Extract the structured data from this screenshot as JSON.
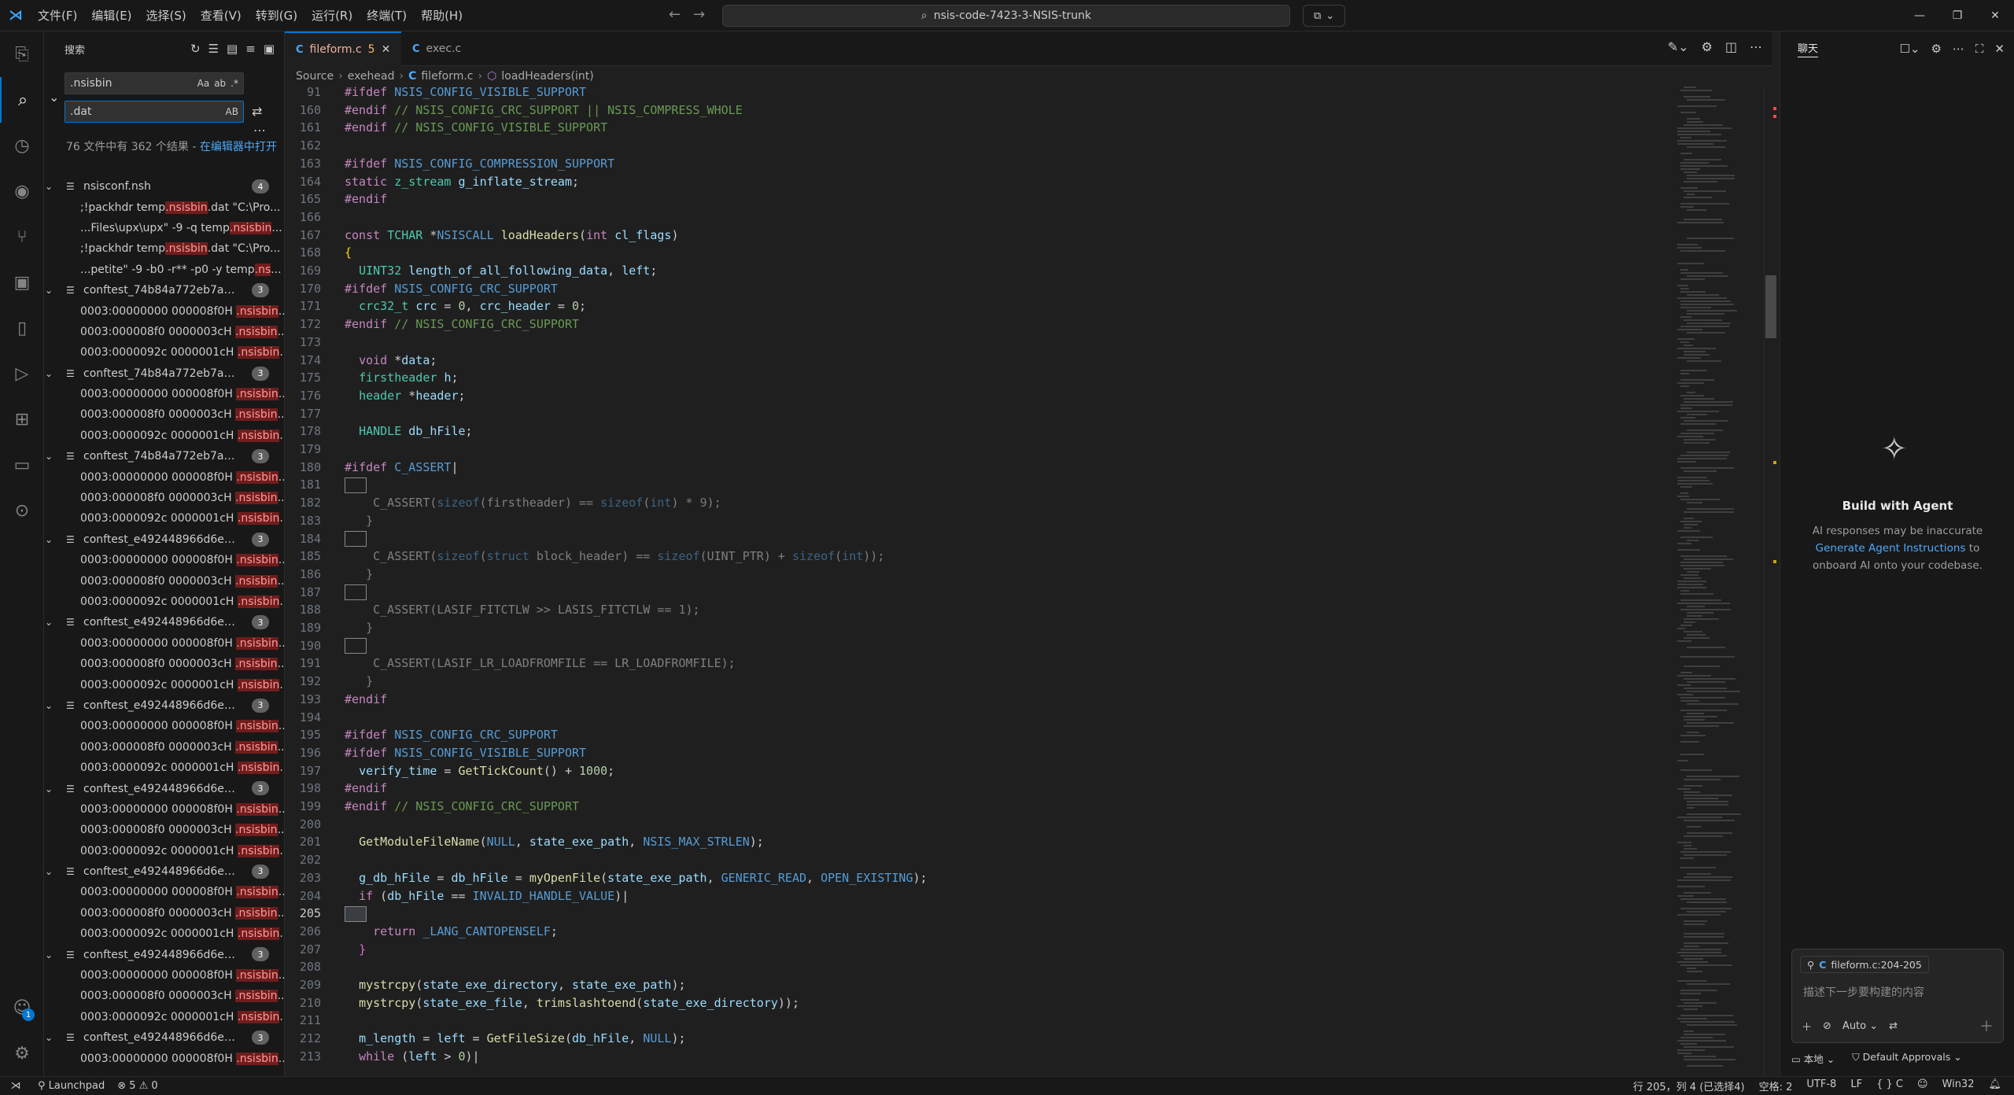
{
  "titlebar": {
    "logo": "⋊",
    "menu": [
      "文件(F)",
      "编辑(E)",
      "选择(S)",
      "查看(V)",
      "转到(G)",
      "运行(R)",
      "终端(T)",
      "帮助(H)"
    ],
    "command_center": "nsis-code-7423-3-NSIS-trunk",
    "search_icon": "search-icon",
    "copilot_icon": "copilot-icon"
  },
  "sidebar": {
    "title": "搜索",
    "search_value": ".nsisbin",
    "search_opts": [
      "Aa",
      "ab",
      ".*"
    ],
    "replace_value": ".dat",
    "replace_opt": "AB",
    "summary_a": "76 文件中有 362 个结果 - ",
    "summary_link": "在编辑器中打开",
    "results": [
      {
        "type": "file",
        "name": "nsisconf.nsh",
        "count": "4",
        "top": 0
      },
      {
        "type": "match",
        "pre": ";!packhdr temp",
        "hl": ".nsisbin",
        "post": ".dat \"C:\\Pro..."
      },
      {
        "type": "match",
        "pre": "...Files\\upx\\upx\" -9 -q temp",
        "hl": ".nsisbin",
        "post": "..."
      },
      {
        "type": "match",
        "pre": ";!packhdr temp",
        "hl": ".nsisbin",
        "post": ".dat \"C:\\Pro..."
      },
      {
        "type": "match",
        "pre": "...petite\" -9 -b0 -r** -p0 -y temp",
        "hl": ".ns",
        "post": "..."
      },
      {
        "type": "file",
        "name": "conftest_74b84a772eb7a0f...",
        "count": "3"
      },
      {
        "type": "match",
        "pre": "0003:00000000 000008f0H ",
        "hl": ".nsisbin",
        "post": "..."
      },
      {
        "type": "match",
        "pre": "0003:000008f0 0000003cH ",
        "hl": ".nsisbin",
        "post": "..."
      },
      {
        "type": "match",
        "pre": "0003:0000092c 0000001cH ",
        "hl": ".nsisbin",
        "post": "..."
      },
      {
        "type": "file",
        "name": "conftest_74b84a772eb7a0f...",
        "count": "3"
      },
      {
        "type": "match",
        "pre": "0003:00000000 000008f0H ",
        "hl": ".nsisbin",
        "post": "..."
      },
      {
        "type": "match",
        "pre": "0003:000008f0 0000003cH ",
        "hl": ".nsisbin",
        "post": "..."
      },
      {
        "type": "match",
        "pre": "0003:0000092c 0000001cH ",
        "hl": ".nsisbin",
        "post": "..."
      },
      {
        "type": "file",
        "name": "conftest_74b84a772eb7a0f...",
        "count": "3"
      },
      {
        "type": "match",
        "pre": "0003:00000000 000008f0H ",
        "hl": ".nsisbin",
        "post": "..."
      },
      {
        "type": "match",
        "pre": "0003:000008f0 0000003cH ",
        "hl": ".nsisbin",
        "post": "..."
      },
      {
        "type": "match",
        "pre": "0003:0000092c 0000001cH ",
        "hl": ".nsisbin",
        "post": "..."
      },
      {
        "type": "file",
        "name": "conftest_e492448966d6e04...",
        "count": "3"
      },
      {
        "type": "match",
        "pre": "0003:00000000 000008f0H ",
        "hl": ".nsisbin",
        "post": "..."
      },
      {
        "type": "match",
        "pre": "0003:000008f0 0000003cH ",
        "hl": ".nsisbin",
        "post": "..."
      },
      {
        "type": "match",
        "pre": "0003:0000092c 0000001cH ",
        "hl": ".nsisbin",
        "post": "..."
      },
      {
        "type": "file",
        "name": "conftest_e492448966d6e04...",
        "count": "3"
      },
      {
        "type": "match",
        "pre": "0003:00000000 000008f0H ",
        "hl": ".nsisbin",
        "post": "..."
      },
      {
        "type": "match",
        "pre": "0003:000008f0 0000003cH ",
        "hl": ".nsisbin",
        "post": "..."
      },
      {
        "type": "match",
        "pre": "0003:0000092c 0000001cH ",
        "hl": ".nsisbin",
        "post": "..."
      },
      {
        "type": "file",
        "name": "conftest_e492448966d6e04...",
        "count": "3"
      },
      {
        "type": "match",
        "pre": "0003:00000000 000008f0H ",
        "hl": ".nsisbin",
        "post": "..."
      },
      {
        "type": "match",
        "pre": "0003:000008f0 0000003cH ",
        "hl": ".nsisbin",
        "post": "..."
      },
      {
        "type": "match",
        "pre": "0003:0000092c 0000001cH ",
        "hl": ".nsisbin",
        "post": "..."
      },
      {
        "type": "file",
        "name": "conftest_e492448966d6e04...",
        "count": "3"
      },
      {
        "type": "match",
        "pre": "0003:00000000 000008f0H ",
        "hl": ".nsisbin",
        "post": "..."
      },
      {
        "type": "match",
        "pre": "0003:000008f0 0000003cH ",
        "hl": ".nsisbin",
        "post": "..."
      },
      {
        "type": "match",
        "pre": "0003:0000092c 0000001cH ",
        "hl": ".nsisbin",
        "post": "..."
      },
      {
        "type": "file",
        "name": "conftest_e492448966d6e04...",
        "count": "3"
      },
      {
        "type": "match",
        "pre": "0003:00000000 000008f0H ",
        "hl": ".nsisbin",
        "post": "..."
      },
      {
        "type": "match",
        "pre": "0003:000008f0 0000003cH ",
        "hl": ".nsisbin",
        "post": "..."
      },
      {
        "type": "match",
        "pre": "0003:0000092c 0000001cH ",
        "hl": ".nsisbin",
        "post": "..."
      },
      {
        "type": "file",
        "name": "conftest_e492448966d6e04...",
        "count": "3"
      },
      {
        "type": "match",
        "pre": "0003:00000000 000008f0H ",
        "hl": ".nsisbin",
        "post": "..."
      },
      {
        "type": "match",
        "pre": "0003:000008f0 0000003cH ",
        "hl": ".nsisbin",
        "post": "..."
      },
      {
        "type": "match",
        "pre": "0003:0000092c 0000001cH ",
        "hl": ".nsisbin",
        "post": "..."
      },
      {
        "type": "file",
        "name": "conftest_e492448966d6e04...",
        "count": "3"
      },
      {
        "type": "match",
        "pre": "0003:00000000 000008f0H ",
        "hl": ".nsisbin",
        "post": "..."
      }
    ]
  },
  "tabs": [
    {
      "name": "fileform.c",
      "mod": "5",
      "active": true
    },
    {
      "name": "exec.c",
      "mod": "",
      "active": false
    }
  ],
  "breadcrumb": {
    "a": "Source",
    "b": "exehead",
    "c": "fileform.c",
    "d": "loadHeaders(int)"
  },
  "code": [
    {
      "n": "91",
      "h": "<span class='mac'>#ifdef</span> <span class='mc'>NSIS_CONFIG_VISIBLE_SUPPORT</span>"
    },
    {
      "n": "160",
      "h": "<span class='mac'>#endif</span> <span class='cm'>// NSIS_CONFIG_CRC_SUPPORT || NSIS_COMPRESS_WHOLE</span>"
    },
    {
      "n": "161",
      "h": "<span class='mac'>#endif</span> <span class='cm'>// NSIS_CONFIG_VISIBLE_SUPPORT</span>"
    },
    {
      "n": "162",
      "h": ""
    },
    {
      "n": "163",
      "h": "<span class='mac'>#ifdef</span> <span class='mc'>NSIS_CONFIG_COMPRESSION_SUPPORT</span>"
    },
    {
      "n": "164",
      "h": "<span class='k'>static</span> <span class='ty'>z_stream</span> <span class='v'>g_inflate_stream</span>;"
    },
    {
      "n": "165",
      "h": "<span class='mac'>#endif</span>"
    },
    {
      "n": "166",
      "h": ""
    },
    {
      "n": "167",
      "h": "<span class='k'>const</span> <span class='ty'>TCHAR</span> *<span class='mc'>NSISCALL</span> <span class='fn'>loadHeaders</span>(<span class='k'>int</span> <span class='v'>cl_flags</span>)"
    },
    {
      "n": "168",
      "h": "<span style='color:#ffd700'>{</span>"
    },
    {
      "n": "169",
      "h": "  <span class='ty'>UINT32</span> <span class='v'>length_of_all_following_data</span>, <span class='v'>left</span>;"
    },
    {
      "n": "170",
      "h": "<span class='mac'>#ifdef</span> <span class='mc'>NSIS_CONFIG_CRC_SUPPORT</span>"
    },
    {
      "n": "171",
      "h": "  <span class='ty'>crc32_t</span> <span class='v'>crc</span> = <span class='num'>0</span>, <span class='v'>crc_header</span> = <span class='num'>0</span>;"
    },
    {
      "n": "172",
      "h": "<span class='mac'>#endif</span> <span class='cm'>// NSIS_CONFIG_CRC_SUPPORT</span>"
    },
    {
      "n": "173",
      "h": ""
    },
    {
      "n": "174",
      "h": "  <span class='k'>void</span> *<span class='v'>data</span>;"
    },
    {
      "n": "175",
      "h": "  <span class='ty'>firstheader</span> <span class='v'>h</span>;"
    },
    {
      "n": "176",
      "h": "  <span class='ty'>header</span> *<span class='v'>header</span>;"
    },
    {
      "n": "177",
      "h": ""
    },
    {
      "n": "178",
      "h": "  <span class='ty'>HANDLE</span> <span class='v'>db_hFile</span>;"
    },
    {
      "n": "179",
      "h": ""
    },
    {
      "n": "180",
      "h": "<span class='mac'>#ifdef</span> <span class='mc'>C_ASSERT</span>|"
    },
    {
      "n": "181",
      "h": "<span class='bracebox'></span>"
    },
    {
      "n": "182",
      "h": "<span class='dim'>    C_ASSERT(<span class='mc'>sizeof</span>(firstheader) == <span class='mc'>sizeof</span>(<span class='mc'>int</span>) * <span class='num'>9</span>);</span>"
    },
    {
      "n": "183",
      "h": "<span class='dim'>   }</span>"
    },
    {
      "n": "184",
      "h": "<span class='bracebox'></span>"
    },
    {
      "n": "185",
      "h": "<span class='dim'>    C_ASSERT(<span class='mc'>sizeof</span>(<span class='mc'>struct</span> block_header) == <span class='mc'>sizeof</span>(UINT_PTR) + <span class='mc'>sizeof</span>(<span class='mc'>int</span>));</span>"
    },
    {
      "n": "186",
      "h": "<span class='dim'>   }</span>"
    },
    {
      "n": "187",
      "h": "<span class='bracebox'></span>"
    },
    {
      "n": "188",
      "h": "<span class='dim'>    C_ASSERT(LASIF_FITCTLW &gt;&gt; LASIS_FITCTLW == <span class='num'>1</span>);</span>"
    },
    {
      "n": "189",
      "h": "<span class='dim'>   }</span>"
    },
    {
      "n": "190",
      "h": "<span class='bracebox'></span>"
    },
    {
      "n": "191",
      "h": "<span class='dim'>    C_ASSERT(LASIF_LR_LOADFROMFILE == LR_LOADFROMFILE);</span>"
    },
    {
      "n": "192",
      "h": "<span class='dim'>   }</span>"
    },
    {
      "n": "193",
      "h": "<span class='mac'>#endif</span>"
    },
    {
      "n": "194",
      "h": ""
    },
    {
      "n": "195",
      "h": "<span class='mac'>#ifdef</span> <span class='mc'>NSIS_CONFIG_CRC_SUPPORT</span>"
    },
    {
      "n": "196",
      "h": "<span class='mac'>#ifdef</span> <span class='mc'>NSIS_CONFIG_VISIBLE_SUPPORT</span>"
    },
    {
      "n": "197",
      "h": "  <span class='v'>verify_time</span> = <span class='fn'>GetTickCount</span>() + <span class='num'>1000</span>;"
    },
    {
      "n": "198",
      "h": "<span class='mac'>#endif</span>"
    },
    {
      "n": "199",
      "h": "<span class='mac'>#endif</span> <span class='cm'>// NSIS_CONFIG_CRC_SUPPORT</span>"
    },
    {
      "n": "200",
      "h": ""
    },
    {
      "n": "201",
      "h": "  <span class='fn'>GetModuleFileName</span>(<span class='mc'>NULL</span>, <span class='v'>state_exe_path</span>, <span class='mc'>NSIS_MAX_STRLEN</span>);"
    },
    {
      "n": "202",
      "h": ""
    },
    {
      "n": "203",
      "h": "  <span class='v'>g_db_hFile</span> = <span class='v'>db_hFile</span> = <span class='fn'>myOpenFile</span>(<span class='v'>state_exe_path</span>, <span class='mc'>GENERIC_READ</span>, <span class='mc'>OPEN_EXISTING</span>);"
    },
    {
      "n": "204",
      "h": "  <span class='k'>if</span> (<span class='v'>db_hFile</span> == <span class='mc'>INVALID_HANDLE_VALUE</span>)|"
    },
    {
      "n": "205",
      "h": "<span class='bracebox' style='background:#3a3d41'></span>",
      "cur": true
    },
    {
      "n": "206",
      "h": "    <span class='k'>return</span> <span class='mc'>_LANG_CANTOPENSELF</span>;"
    },
    {
      "n": "207",
      "h": "  <span style='color:#da70d6'>}</span>"
    },
    {
      "n": "208",
      "h": ""
    },
    {
      "n": "209",
      "h": "  <span class='fn'>mystrcpy</span>(<span class='v'>state_exe_directory</span>, <span class='v'>state_exe_path</span>);"
    },
    {
      "n": "210",
      "h": "  <span class='fn'>mystrcpy</span>(<span class='v'>state_exe_file</span>, <span class='fn'>trimslashtoend</span>(<span class='v'>state_exe_directory</span>));"
    },
    {
      "n": "211",
      "h": ""
    },
    {
      "n": "212",
      "h": "  <span class='v'>m_length</span> = <span class='v'>left</span> = <span class='fn'>GetFileSize</span>(<span class='v'>db_hFile</span>, <span class='mc'>NULL</span>);"
    },
    {
      "n": "213",
      "h": "  <span class='k'>while</span> (<span class='v'>left</span> &gt; <span class='num'>0</span>)|"
    }
  ],
  "chat": {
    "title": "聊天",
    "agent_title": "Build with Agent",
    "agent_desc_a": "AI responses may be inaccurate",
    "agent_link": "Generate Agent Instructions",
    "agent_desc_b": " to onboard AI onto your codebase.",
    "context": "fileform.c:204-205",
    "placeholder": "描述下一步要构建的内容",
    "mode": "Auto",
    "foot_a": "本地",
    "foot_b": "Default Approvals"
  },
  "status": {
    "launchpad": "Launchpad",
    "problems": "⊗ 5 ⚠ 0",
    "pos": "行 205，列 4 (已选择4)",
    "spaces": "空格: 2",
    "enc": "UTF-8",
    "eol": "LF",
    "lang": "{ } C",
    "plat": "Win32"
  }
}
